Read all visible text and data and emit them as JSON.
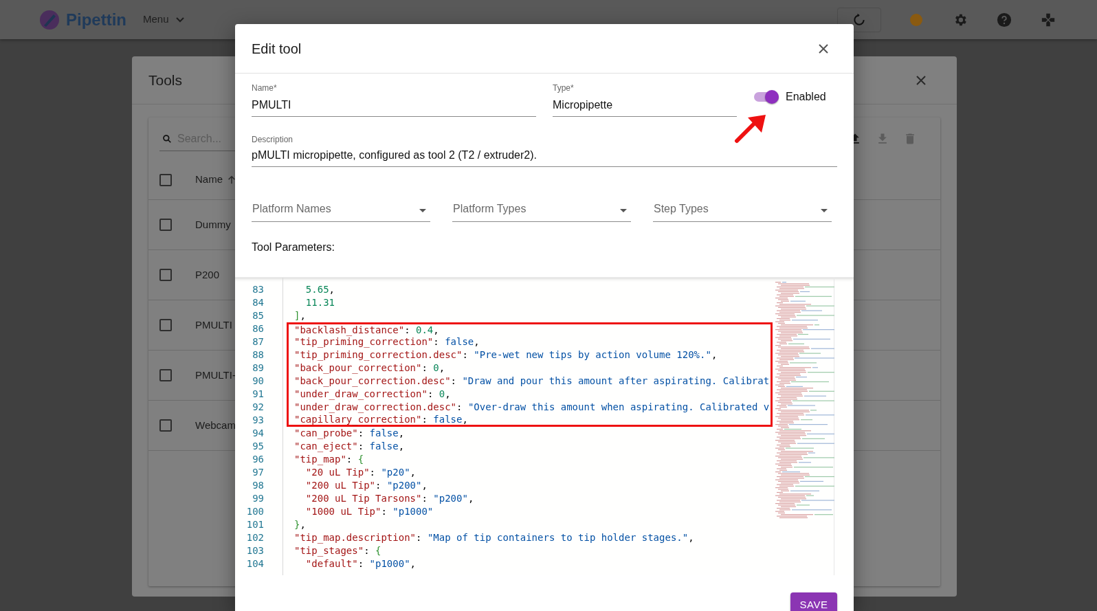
{
  "app_bar": {
    "brand": "Pipettin",
    "menu": "Menu"
  },
  "tools_dialog": {
    "title": "Tools",
    "search": {
      "placeholder": "Search..."
    },
    "select_all": {
      "checked": false
    },
    "name_column": {
      "label": "Name",
      "sorted_ascending": true
    },
    "rows": [
      {
        "name": "Dummy",
        "checked": false
      },
      {
        "name": "P200",
        "checked": false
      },
      {
        "name": "PMULTI",
        "checked": false
      },
      {
        "name": "PMULTI-",
        "checked": false
      },
      {
        "name": "Webcam",
        "checked": false
      }
    ]
  },
  "edit_dialog": {
    "title": "Edit tool",
    "name": {
      "label": "Name*",
      "value": "PMULTI"
    },
    "type": {
      "label": "Type*",
      "value": "Micropipette"
    },
    "enabled": {
      "label": "Enabled",
      "on": true
    },
    "description": {
      "label": "Description",
      "value": "pMULTI micropipette, configured as tool 2 (T2 / extruder2)."
    },
    "selects": [
      {
        "placeholder": "Platform Names"
      },
      {
        "placeholder": "Platform Types"
      },
      {
        "placeholder": "Step Types"
      }
    ],
    "parameters_label": "Tool Parameters:",
    "code_lines": [
      {
        "number": "83",
        "highlighted": false,
        "tokens": [
          {
            "kind": "number",
            "text": "  5.65"
          },
          {
            "kind": "punct",
            "text": ","
          }
        ]
      },
      {
        "number": "84",
        "highlighted": false,
        "tokens": [
          {
            "kind": "number",
            "text": "  11.31"
          }
        ]
      },
      {
        "number": "85",
        "highlighted": false,
        "tokens": [
          {
            "kind": "bracket",
            "text": "]"
          },
          {
            "kind": "punct",
            "text": ","
          }
        ]
      },
      {
        "number": "86",
        "highlighted": true,
        "tokens": [
          {
            "kind": "key",
            "text": "\"backlash_distance\""
          },
          {
            "kind": "punct",
            "text": ": "
          },
          {
            "kind": "number",
            "text": "0.4"
          },
          {
            "kind": "punct",
            "text": ","
          }
        ]
      },
      {
        "number": "87",
        "highlighted": true,
        "tokens": [
          {
            "kind": "key",
            "text": "\"tip_priming_correction\""
          },
          {
            "kind": "punct",
            "text": ": "
          },
          {
            "kind": "boolean",
            "text": "false"
          },
          {
            "kind": "punct",
            "text": ","
          }
        ]
      },
      {
        "number": "88",
        "highlighted": true,
        "tokens": [
          {
            "kind": "key",
            "text": "\"tip_priming_correction.desc\""
          },
          {
            "kind": "punct",
            "text": ": "
          },
          {
            "kind": "string",
            "text": "\"Pre-wet new tips by action volume 120%.\""
          },
          {
            "kind": "punct",
            "text": ","
          }
        ]
      },
      {
        "number": "89",
        "highlighted": true,
        "tokens": [
          {
            "kind": "key",
            "text": "\"back_pour_correction\""
          },
          {
            "kind": "punct",
            "text": ": "
          },
          {
            "kind": "number",
            "text": "0"
          },
          {
            "kind": "punct",
            "text": ","
          }
        ]
      },
      {
        "number": "90",
        "highlighted": true,
        "tokens": [
          {
            "kind": "key",
            "text": "\"back_pour_correction.desc\""
          },
          {
            "kind": "punct",
            "text": ": "
          },
          {
            "kind": "string",
            "text": "\"Draw and pour this amount after aspirating. Calibrat"
          }
        ]
      },
      {
        "number": "91",
        "highlighted": true,
        "tokens": [
          {
            "kind": "key",
            "text": "\"under_draw_correction\""
          },
          {
            "kind": "punct",
            "text": ": "
          },
          {
            "kind": "number",
            "text": "0"
          },
          {
            "kind": "punct",
            "text": ","
          }
        ]
      },
      {
        "number": "92",
        "highlighted": true,
        "tokens": [
          {
            "kind": "key",
            "text": "\"under_draw_correction.desc\""
          },
          {
            "kind": "punct",
            "text": ": "
          },
          {
            "kind": "string",
            "text": "\"Over-draw this amount when aspirating. Calibrated v"
          }
        ]
      },
      {
        "number": "93",
        "highlighted": true,
        "tokens": [
          {
            "kind": "key",
            "text": "\"capillary_correction\""
          },
          {
            "kind": "punct",
            "text": ": "
          },
          {
            "kind": "boolean",
            "text": "false"
          },
          {
            "kind": "punct",
            "text": ","
          }
        ]
      },
      {
        "number": "94",
        "highlighted": false,
        "tokens": [
          {
            "kind": "key",
            "text": "\"can_probe\""
          },
          {
            "kind": "punct",
            "text": ": "
          },
          {
            "kind": "boolean",
            "text": "false"
          },
          {
            "kind": "punct",
            "text": ","
          }
        ]
      },
      {
        "number": "95",
        "highlighted": false,
        "tokens": [
          {
            "kind": "key",
            "text": "\"can_eject\""
          },
          {
            "kind": "punct",
            "text": ": "
          },
          {
            "kind": "boolean",
            "text": "false"
          },
          {
            "kind": "punct",
            "text": ","
          }
        ]
      },
      {
        "number": "96",
        "highlighted": false,
        "tokens": [
          {
            "kind": "key",
            "text": "\"tip_map\""
          },
          {
            "kind": "punct",
            "text": ": "
          },
          {
            "kind": "bracket",
            "text": "{"
          }
        ]
      },
      {
        "number": "97",
        "highlighted": false,
        "tokens": [
          {
            "kind": "key",
            "text": "  \"20 uL Tip\""
          },
          {
            "kind": "punct",
            "text": ": "
          },
          {
            "kind": "string",
            "text": "\"p20\""
          },
          {
            "kind": "punct",
            "text": ","
          }
        ]
      },
      {
        "number": "98",
        "highlighted": false,
        "tokens": [
          {
            "kind": "key",
            "text": "  \"200 uL Tip\""
          },
          {
            "kind": "punct",
            "text": ": "
          },
          {
            "kind": "string",
            "text": "\"p200\""
          },
          {
            "kind": "punct",
            "text": ","
          }
        ]
      },
      {
        "number": "99",
        "highlighted": false,
        "tokens": [
          {
            "kind": "key",
            "text": "  \"200 uL Tip Tarsons\""
          },
          {
            "kind": "punct",
            "text": ": "
          },
          {
            "kind": "string",
            "text": "\"p200\""
          },
          {
            "kind": "punct",
            "text": ","
          }
        ]
      },
      {
        "number": "100",
        "highlighted": false,
        "tokens": [
          {
            "kind": "key",
            "text": "  \"1000 uL Tip\""
          },
          {
            "kind": "punct",
            "text": ": "
          },
          {
            "kind": "string",
            "text": "\"p1000\""
          }
        ]
      },
      {
        "number": "101",
        "highlighted": false,
        "tokens": [
          {
            "kind": "bracket",
            "text": "}"
          },
          {
            "kind": "punct",
            "text": ","
          }
        ]
      },
      {
        "number": "102",
        "highlighted": false,
        "tokens": [
          {
            "kind": "key",
            "text": "\"tip_map.description\""
          },
          {
            "kind": "punct",
            "text": ": "
          },
          {
            "kind": "string",
            "text": "\"Map of tip containers to tip holder stages.\""
          },
          {
            "kind": "punct",
            "text": ","
          }
        ]
      },
      {
        "number": "103",
        "highlighted": false,
        "tokens": [
          {
            "kind": "key",
            "text": "\"tip_stages\""
          },
          {
            "kind": "punct",
            "text": ": "
          },
          {
            "kind": "bracket",
            "text": "{"
          }
        ]
      },
      {
        "number": "104",
        "highlighted": false,
        "tokens": [
          {
            "kind": "key",
            "text": "  \"default\""
          },
          {
            "kind": "punct",
            "text": ": "
          },
          {
            "kind": "string",
            "text": "\"p1000\""
          },
          {
            "kind": "punct",
            "text": ","
          }
        ]
      }
    ],
    "save_button": "SAVE"
  }
}
